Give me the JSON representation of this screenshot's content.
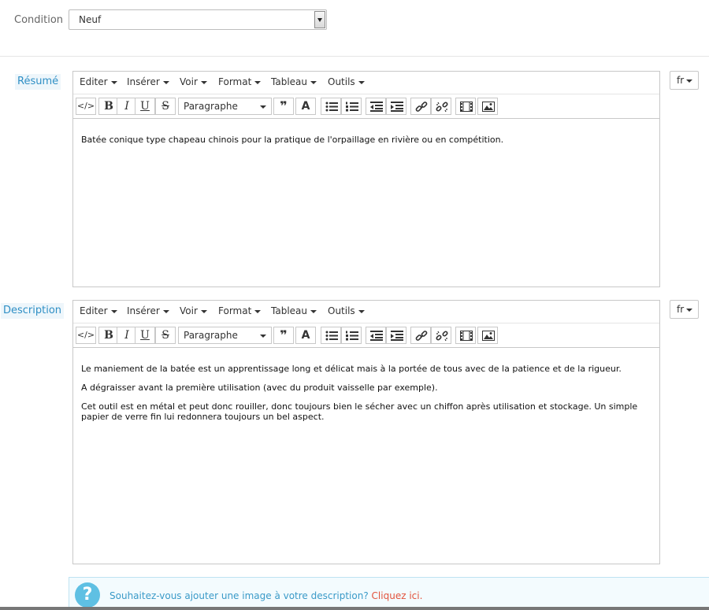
{
  "condition": {
    "label": "Condition",
    "value": "Neuf"
  },
  "menu": [
    "Editer",
    "Insérer",
    "Voir",
    "Format",
    "Tableau",
    "Outils"
  ],
  "toolbar": {
    "bold": "B",
    "italic": "I",
    "underline": "U",
    "strike": "S",
    "block_format": "Paragraphe"
  },
  "summary": {
    "label": "Résumé",
    "lang": "fr",
    "paragraphs": [
      "Batée conique type chapeau chinois pour la pratique de l'orpaillage en rivière ou en compétition."
    ]
  },
  "description": {
    "label": "Description",
    "lang": "fr",
    "paragraphs": [
      "Le maniement de la batée est un apprentissage long et délicat mais à la portée de tous avec de la patience et de la rigueur.",
      "A dégraisser avant la première utilisation (avec du produit vaisselle par exemple).",
      "Cet outil est en métal et peut donc rouiller, donc toujours bien le sécher avec un chiffon après utilisation et stockage. Un simple papier de verre fin lui redonnera toujours un bel aspect."
    ]
  },
  "info": {
    "icon": "question-icon",
    "icon_glyph": "?",
    "text": "Souhaitez-vous ajouter une image à votre description?",
    "link": "Cliquez ici."
  }
}
